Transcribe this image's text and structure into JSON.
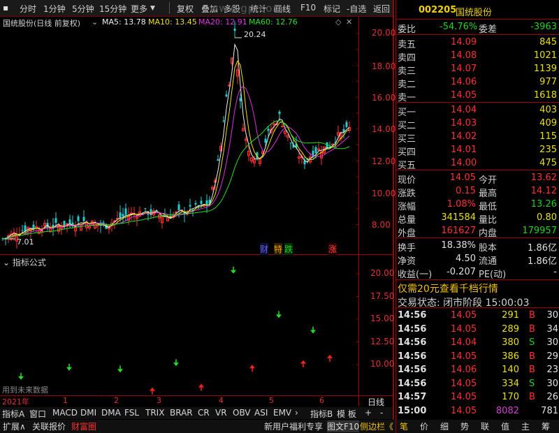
{
  "toolbar": {
    "items": [
      "分时",
      "1分钟",
      "5分钟",
      "15分钟",
      "更多",
      "复权",
      "叠加",
      "多股",
      "统计",
      "画线",
      "F10",
      "标记",
      "-自选",
      "返回"
    ],
    "watermark": "www.gp.com"
  },
  "chart_header": {
    "title": "国统股份(日线 前复权)",
    "ma5": "MA5: 13.78",
    "ma10": "MA10: 13.45",
    "ma20": "MA20: 12.91",
    "ma60": "MA60: 12.76"
  },
  "price_axis": {
    "labels": [
      "20.00",
      "18.00",
      "16.00",
      "14.00",
      "12.00",
      "10.00",
      "8.00"
    ],
    "high_label": "20.24",
    "low_label": "7.01"
  },
  "event_marks": {
    "cai": "财",
    "zhu": "特",
    "die": "跌",
    "zhang": "涨"
  },
  "indicator": {
    "title": "指标公式",
    "labels": [
      "20.00",
      "17.50",
      "15.00",
      "12.50",
      "10.00"
    ],
    "note": "用到未来数据"
  },
  "time_axis": {
    "labels": [
      "2021年",
      "1",
      "2",
      "3",
      "4",
      "5",
      "6"
    ],
    "right": "日线"
  },
  "tabs": [
    "指标A",
    "窗口",
    "MACD",
    "DMI",
    "DMA",
    "FSL",
    "TRIX",
    "BRAR",
    "CR",
    "VR",
    "OBV",
    "ASI",
    "EMV"
  ],
  "tabs_right": {
    "a": "指标B",
    "b": "模 板",
    "c": "+",
    "d": "-"
  },
  "bottom": {
    "left": [
      "扩展∧",
      "关联报价",
      "财富圈"
    ],
    "mid": [
      "新用户福利专享",
      "图文F10",
      "侧边栏《"
    ],
    "right": [
      "笔",
      "价",
      "细",
      "势",
      "联",
      "值",
      "主",
      "筹"
    ]
  },
  "stock": {
    "code": "002205",
    "name": "国统股份"
  },
  "weibi": {
    "l1": "委比",
    "v1": "-54.76%",
    "l2": "委差",
    "v2": "-3963"
  },
  "asks": [
    {
      "l": "卖五",
      "p": "14.09",
      "v": "845"
    },
    {
      "l": "卖四",
      "p": "14.08",
      "v": "1021"
    },
    {
      "l": "卖三",
      "p": "14.07",
      "v": "1139"
    },
    {
      "l": "卖二",
      "p": "14.06",
      "v": "977"
    },
    {
      "l": "卖一",
      "p": "14.05",
      "v": "1618"
    }
  ],
  "bids": [
    {
      "l": "买一",
      "p": "14.04",
      "v": "403"
    },
    {
      "l": "买二",
      "p": "14.03",
      "v": "409"
    },
    {
      "l": "买三",
      "p": "14.02",
      "v": "115"
    },
    {
      "l": "买四",
      "p": "14.01",
      "v": "235"
    },
    {
      "l": "买五",
      "p": "14.00",
      "v": "475"
    }
  ],
  "quote": [
    {
      "l1": "现价",
      "v1": "14.05",
      "l2": "今开",
      "v2": "13.62"
    },
    {
      "l1": "涨跌",
      "v1": "0.15",
      "l2": "最高",
      "v2": "14.12"
    },
    {
      "l1": "涨幅",
      "v1": "1.08%",
      "l2": "最低",
      "v2": "13.26"
    },
    {
      "l1": "总量",
      "v1": "341584",
      "l2": "量比",
      "v2": "0.80"
    },
    {
      "l1": "外盘",
      "v1": "161627",
      "l2": "内盘",
      "v2": "179957"
    }
  ],
  "quote2": [
    {
      "l1": "换手",
      "v1": "18.38%",
      "l2": "股本",
      "v2": "1.86亿"
    },
    {
      "l1": "净资",
      "v1": "4.50",
      "l2": "流通",
      "v2": "1.86亿"
    },
    {
      "l1": "收益(一)",
      "v1": "-0.207",
      "l2": "PE(动)",
      "v2": "-"
    }
  ],
  "promo": "仅需20元查看千档行情",
  "status": "交易状态: 闭市阶段  15:00:03",
  "ticks": [
    {
      "t": "14:56",
      "p": "14.05",
      "v": "291",
      "s": "B",
      "n": "30"
    },
    {
      "t": "14:56",
      "p": "14.05",
      "v": "289",
      "s": "B",
      "n": "34"
    },
    {
      "t": "14:56",
      "p": "14.04",
      "v": "380",
      "s": "S",
      "n": "30"
    },
    {
      "t": "14:56",
      "p": "14.05",
      "v": "386",
      "s": "B",
      "n": "29"
    },
    {
      "t": "14:56",
      "p": "14.06",
      "v": "140",
      "s": "B",
      "n": "23"
    },
    {
      "t": "14:56",
      "p": "14.05",
      "v": "334",
      "s": "S",
      "n": "30"
    },
    {
      "t": "14:57",
      "p": "14.05",
      "v": "170",
      "s": "B",
      "n": "26"
    },
    {
      "t": "15:00",
      "p": "14.05",
      "v": "8082",
      "s": "",
      "n": "781"
    }
  ]
}
